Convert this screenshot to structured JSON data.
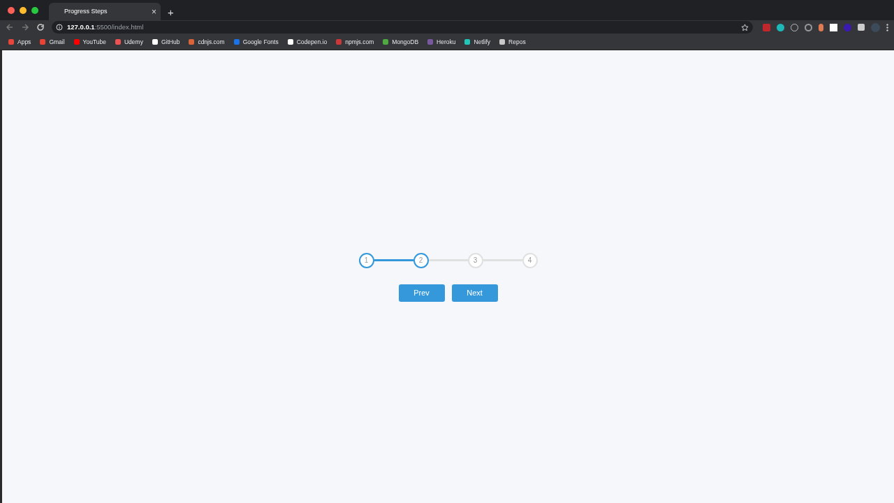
{
  "browser": {
    "tab": {
      "title": "Progress Steps",
      "close": "×"
    },
    "new_tab": "+",
    "address": {
      "host": "127.0.0.1",
      "path": ":5500/index.html"
    },
    "bookmarks": [
      {
        "label": "Apps",
        "color": "#e8453c"
      },
      {
        "label": "Gmail",
        "color": "#ea4335"
      },
      {
        "label": "YouTube",
        "color": "#ff0000"
      },
      {
        "label": "Udemy",
        "color": "#ec5252"
      },
      {
        "label": "GitHub",
        "color": "#ffffff"
      },
      {
        "label": "cdnjs.com",
        "color": "#d9643a"
      },
      {
        "label": "Google Fonts",
        "color": "#1a73e8"
      },
      {
        "label": "Codepen.io",
        "color": "#ffffff"
      },
      {
        "label": "npmjs.com",
        "color": "#cb3837"
      },
      {
        "label": "MongoDB",
        "color": "#4faa41"
      },
      {
        "label": "Heroku",
        "color": "#79589f"
      },
      {
        "label": "Netlify",
        "color": "#20c6b7"
      },
      {
        "label": "Repos",
        "color": "#c8c8c8"
      }
    ]
  },
  "progress": {
    "connectors": [
      {
        "active": true
      },
      {
        "active": false
      },
      {
        "active": false
      }
    ],
    "steps": [
      {
        "label": "1",
        "active": true
      },
      {
        "label": "2",
        "active": true
      },
      {
        "label": "3",
        "active": false
      },
      {
        "label": "4",
        "active": false
      }
    ]
  },
  "buttons": [
    {
      "label": "Prev",
      "disabled": false
    },
    {
      "label": "Next",
      "disabled": false
    }
  ]
}
